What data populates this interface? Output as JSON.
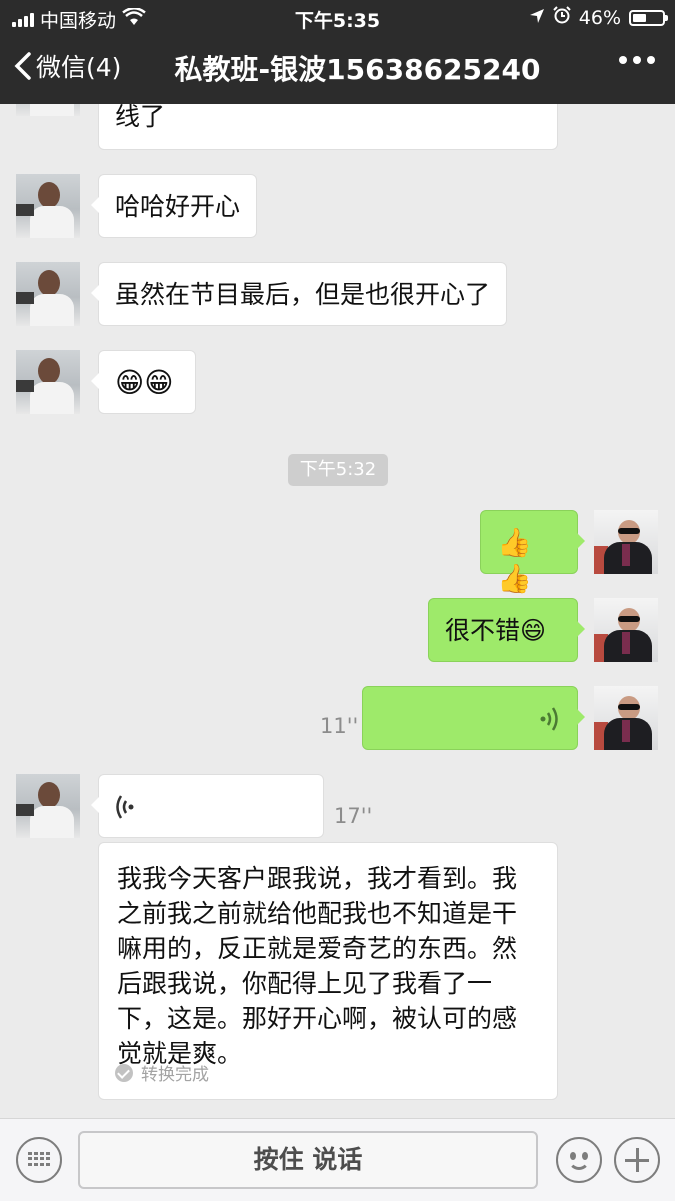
{
  "status": {
    "carrier": "中国移动",
    "time": "下午5:35",
    "battery": "46%",
    "battery_level": 0.46
  },
  "nav": {
    "back_label": "微信(4)",
    "title": "私教班-银波15638625240"
  },
  "chat": {
    "messages": [
      {
        "side": "left",
        "text": "线了"
      },
      {
        "side": "left",
        "text": "哈哈好开心"
      },
      {
        "side": "left",
        "text": "虽然在节目最后，但是也很开心了"
      },
      {
        "side": "left",
        "text": "😁😁"
      },
      {
        "side": "right",
        "text": "👍👍"
      },
      {
        "side": "right",
        "text": "很不错😄"
      },
      {
        "side": "right",
        "type": "voice",
        "duration": "11''"
      },
      {
        "side": "left",
        "type": "voice",
        "duration": "17''"
      }
    ],
    "timestamp": "下午5:32",
    "transcript": "我我今天客户跟我说，我才看到。我之前我之前就给他配我也不知道是干嘛用的，反正就是爱奇艺的东西。然后跟我说，你配得上见了我看了一下，这是。那好开心啊，被认可的感觉就是爽。",
    "transcript_status": "转换完成"
  },
  "input": {
    "hold_to_talk": "按住 说话"
  },
  "icons": [
    "signal-icon",
    "wifi-icon",
    "location-icon",
    "alarm-icon",
    "battery-icon",
    "back-chevron-icon",
    "more-icon",
    "voice-wave-icon",
    "keyboard-icon",
    "emoji-icon",
    "plus-icon"
  ],
  "colors": {
    "nav_bg": "#2c2c2c",
    "chat_bg": "#ebebeb",
    "sent_bubble": "#9eea6a",
    "received_bubble": "#ffffff"
  }
}
